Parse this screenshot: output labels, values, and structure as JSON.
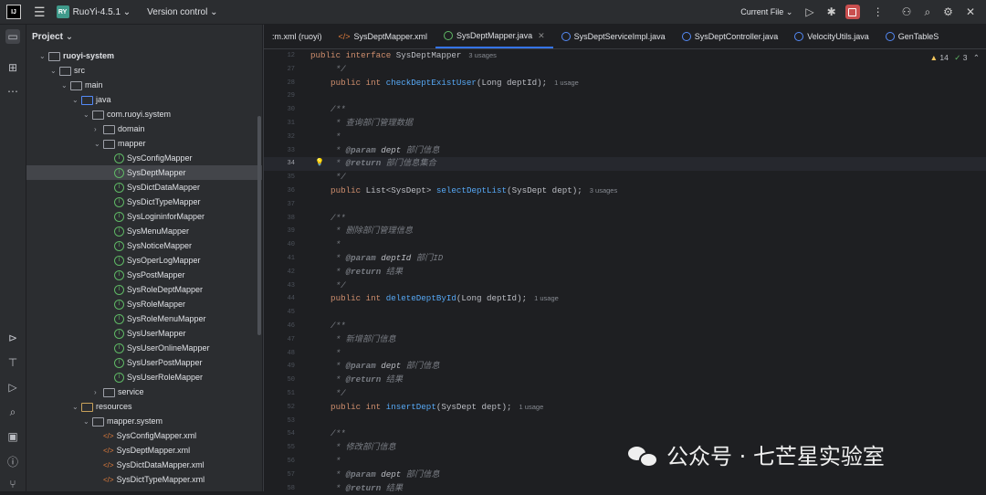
{
  "titlebar": {
    "project_badge": "RY",
    "project_name": "RuoYi-4.5.1",
    "version_control": "Version control",
    "run_config": "Current File"
  },
  "project_panel": {
    "title": "Project",
    "items": [
      {
        "label": "ruoyi-system",
        "type": "module",
        "indent": 1,
        "expanded": true
      },
      {
        "label": "src",
        "type": "folder",
        "indent": 2,
        "expanded": true
      },
      {
        "label": "main",
        "type": "folder",
        "indent": 3,
        "expanded": true
      },
      {
        "label": "java",
        "type": "source-folder",
        "indent": 4,
        "expanded": true
      },
      {
        "label": "com.ruoyi.system",
        "type": "package",
        "indent": 5,
        "expanded": true
      },
      {
        "label": "domain",
        "type": "package",
        "indent": 6,
        "expanded": false
      },
      {
        "label": "mapper",
        "type": "package",
        "indent": 6,
        "expanded": true
      },
      {
        "label": "SysConfigMapper",
        "type": "interface",
        "indent": 7
      },
      {
        "label": "SysDeptMapper",
        "type": "interface",
        "indent": 7,
        "selected": true
      },
      {
        "label": "SysDictDataMapper",
        "type": "interface",
        "indent": 7
      },
      {
        "label": "SysDictTypeMapper",
        "type": "interface",
        "indent": 7
      },
      {
        "label": "SysLogininforMapper",
        "type": "interface",
        "indent": 7
      },
      {
        "label": "SysMenuMapper",
        "type": "interface",
        "indent": 7
      },
      {
        "label": "SysNoticeMapper",
        "type": "interface",
        "indent": 7
      },
      {
        "label": "SysOperLogMapper",
        "type": "interface",
        "indent": 7
      },
      {
        "label": "SysPostMapper",
        "type": "interface",
        "indent": 7
      },
      {
        "label": "SysRoleDeptMapper",
        "type": "interface",
        "indent": 7
      },
      {
        "label": "SysRoleMapper",
        "type": "interface",
        "indent": 7
      },
      {
        "label": "SysRoleMenuMapper",
        "type": "interface",
        "indent": 7
      },
      {
        "label": "SysUserMapper",
        "type": "interface",
        "indent": 7
      },
      {
        "label": "SysUserOnlineMapper",
        "type": "interface",
        "indent": 7
      },
      {
        "label": "SysUserPostMapper",
        "type": "interface",
        "indent": 7
      },
      {
        "label": "SysUserRoleMapper",
        "type": "interface",
        "indent": 7
      },
      {
        "label": "service",
        "type": "package",
        "indent": 6,
        "expanded": false
      },
      {
        "label": "resources",
        "type": "resource-folder",
        "indent": 4,
        "expanded": true
      },
      {
        "label": "mapper.system",
        "type": "folder",
        "indent": 5,
        "expanded": true
      },
      {
        "label": "SysConfigMapper.xml",
        "type": "xml",
        "indent": 6
      },
      {
        "label": "SysDeptMapper.xml",
        "type": "xml",
        "indent": 6
      },
      {
        "label": "SysDictDataMapper.xml",
        "type": "xml",
        "indent": 6
      },
      {
        "label": "SysDictTypeMapper.xml",
        "type": "xml",
        "indent": 6
      }
    ]
  },
  "tabs": [
    {
      "label": ":m.xml (ruoyi)",
      "icon": "none"
    },
    {
      "label": "SysDeptMapper.xml",
      "icon": "xml"
    },
    {
      "label": "SysDeptMapper.java",
      "icon": "interface",
      "active": true
    },
    {
      "label": "SysDeptServiceImpl.java",
      "icon": "class"
    },
    {
      "label": "SysDeptController.java",
      "icon": "class"
    },
    {
      "label": "VelocityUtils.java",
      "icon": "class"
    },
    {
      "label": "GenTableS",
      "icon": "class"
    }
  ],
  "inspections": {
    "warnings": "14",
    "ok": "3"
  },
  "code_lines": [
    {
      "n": "12",
      "parts": [
        [
          "kw",
          "public interface "
        ],
        [
          "cls",
          "SysDeptMapper"
        ]
      ],
      "hint": "3 usages"
    },
    {
      "n": "27",
      "parts": [
        [
          "cmt",
          "     */"
        ]
      ]
    },
    {
      "n": "28",
      "parts": [
        [
          "kw",
          "    public int "
        ],
        [
          "fn",
          "checkDeptExistUser"
        ],
        [
          "cls",
          "(Long deptId);"
        ]
      ],
      "hint": "1 usage"
    },
    {
      "n": "29",
      "parts": []
    },
    {
      "n": "30",
      "parts": [
        [
          "cmt",
          "    /**"
        ]
      ]
    },
    {
      "n": "31",
      "parts": [
        [
          "cmt",
          "     * 查询部门管理数据"
        ]
      ]
    },
    {
      "n": "32",
      "parts": [
        [
          "cmt",
          "     *"
        ]
      ]
    },
    {
      "n": "33",
      "parts": [
        [
          "cmt",
          "     * "
        ],
        [
          "tag",
          "@param"
        ],
        [
          "tagname",
          " dept"
        ],
        [
          "cmt",
          " 部门信息"
        ]
      ]
    },
    {
      "n": "34",
      "parts": [
        [
          "cmt",
          "     * "
        ],
        [
          "tag",
          "@return"
        ],
        [
          "cmt",
          " 部门信息集合"
        ]
      ],
      "highlight": true,
      "bulb": true
    },
    {
      "n": "35",
      "parts": [
        [
          "cmt",
          "     */"
        ]
      ]
    },
    {
      "n": "36",
      "parts": [
        [
          "kw",
          "    public "
        ],
        [
          "cls",
          "List<SysDept> "
        ],
        [
          "fn",
          "selectDeptList"
        ],
        [
          "cls",
          "(SysDept dept);"
        ]
      ],
      "hint": "3 usages"
    },
    {
      "n": "37",
      "parts": []
    },
    {
      "n": "38",
      "parts": [
        [
          "cmt",
          "    /**"
        ]
      ]
    },
    {
      "n": "39",
      "parts": [
        [
          "cmt",
          "     * 删除部门管理信息"
        ]
      ]
    },
    {
      "n": "40",
      "parts": [
        [
          "cmt",
          "     *"
        ]
      ]
    },
    {
      "n": "41",
      "parts": [
        [
          "cmt",
          "     * "
        ],
        [
          "tag",
          "@param"
        ],
        [
          "tagname",
          " deptId"
        ],
        [
          "cmt",
          " 部门ID"
        ]
      ]
    },
    {
      "n": "42",
      "parts": [
        [
          "cmt",
          "     * "
        ],
        [
          "tag",
          "@return"
        ],
        [
          "cmt",
          " 结果"
        ]
      ]
    },
    {
      "n": "43",
      "parts": [
        [
          "cmt",
          "     */"
        ]
      ]
    },
    {
      "n": "44",
      "parts": [
        [
          "kw",
          "    public int "
        ],
        [
          "fn",
          "deleteDeptById"
        ],
        [
          "cls",
          "(Long deptId);"
        ]
      ],
      "hint": "1 usage"
    },
    {
      "n": "45",
      "parts": []
    },
    {
      "n": "46",
      "parts": [
        [
          "cmt",
          "    /**"
        ]
      ]
    },
    {
      "n": "47",
      "parts": [
        [
          "cmt",
          "     * 新增部门信息"
        ]
      ]
    },
    {
      "n": "48",
      "parts": [
        [
          "cmt",
          "     *"
        ]
      ]
    },
    {
      "n": "49",
      "parts": [
        [
          "cmt",
          "     * "
        ],
        [
          "tag",
          "@param"
        ],
        [
          "tagname",
          " dept"
        ],
        [
          "cmt",
          " 部门信息"
        ]
      ]
    },
    {
      "n": "50",
      "parts": [
        [
          "cmt",
          "     * "
        ],
        [
          "tag",
          "@return"
        ],
        [
          "cmt",
          " 结果"
        ]
      ]
    },
    {
      "n": "51",
      "parts": [
        [
          "cmt",
          "     */"
        ]
      ]
    },
    {
      "n": "52",
      "parts": [
        [
          "kw",
          "    public int "
        ],
        [
          "fn",
          "insertDept"
        ],
        [
          "cls",
          "(SysDept dept);"
        ]
      ],
      "hint": "1 usage"
    },
    {
      "n": "53",
      "parts": []
    },
    {
      "n": "54",
      "parts": [
        [
          "cmt",
          "    /**"
        ]
      ]
    },
    {
      "n": "55",
      "parts": [
        [
          "cmt",
          "     * 修改部门信息"
        ]
      ]
    },
    {
      "n": "56",
      "parts": [
        [
          "cmt",
          "     *"
        ]
      ]
    },
    {
      "n": "57",
      "parts": [
        [
          "cmt",
          "     * "
        ],
        [
          "tag",
          "@param"
        ],
        [
          "tagname",
          " dept"
        ],
        [
          "cmt",
          " 部门信息"
        ]
      ]
    },
    {
      "n": "58",
      "parts": [
        [
          "cmt",
          "     * "
        ],
        [
          "tag",
          "@return"
        ],
        [
          "cmt",
          " 结果"
        ]
      ]
    }
  ],
  "watermark": "公众号 · 七芒星实验室"
}
